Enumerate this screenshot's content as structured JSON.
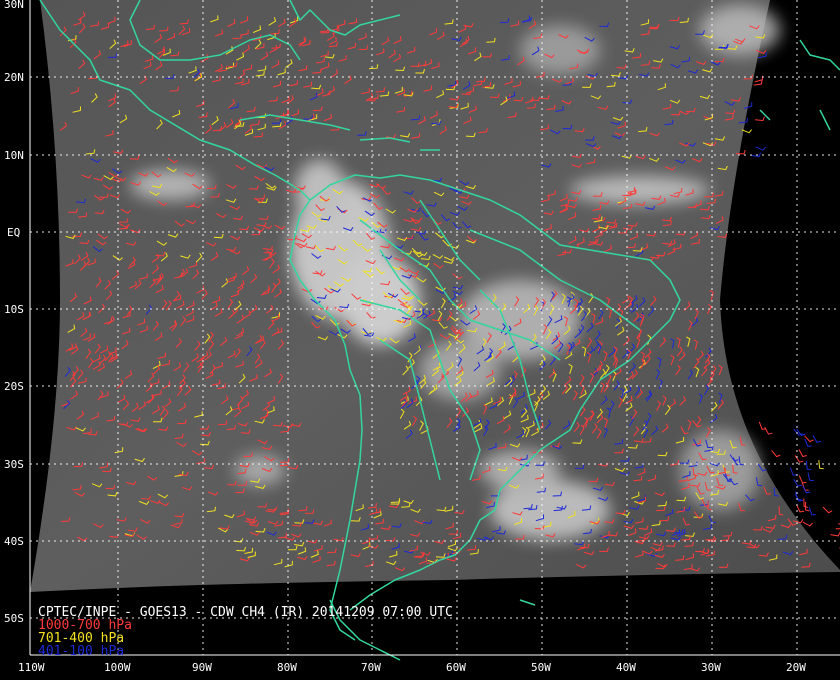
{
  "map": {
    "title": "CPTEC/INPE - GOES13 - CDW CH4 (IR) 20141209 07:00 UTC",
    "lat_labels": [
      "30N",
      "20N",
      "10N",
      "EQ",
      "10S",
      "20S",
      "30S",
      "40S",
      "50S"
    ],
    "lon_labels": [
      "110W",
      "100W",
      "90W",
      "80W",
      "70W",
      "60W",
      "50W",
      "40W",
      "30W",
      "20W"
    ],
    "legend": [
      {
        "label": "1000-700 hPa",
        "color": "#ff3a3a"
      },
      {
        "label": "701-400 hPa",
        "color": "#f2e21f"
      },
      {
        "label": "401-100 hPa",
        "color": "#1c2ad8"
      }
    ],
    "colors": {
      "coastline": "#33d6a0",
      "grid": "#ffffff",
      "background": "#000000",
      "satellite_dark": "#4a4a4a",
      "satellite_light": "#6a6a6a",
      "cloud": "#e6e6e6"
    }
  }
}
